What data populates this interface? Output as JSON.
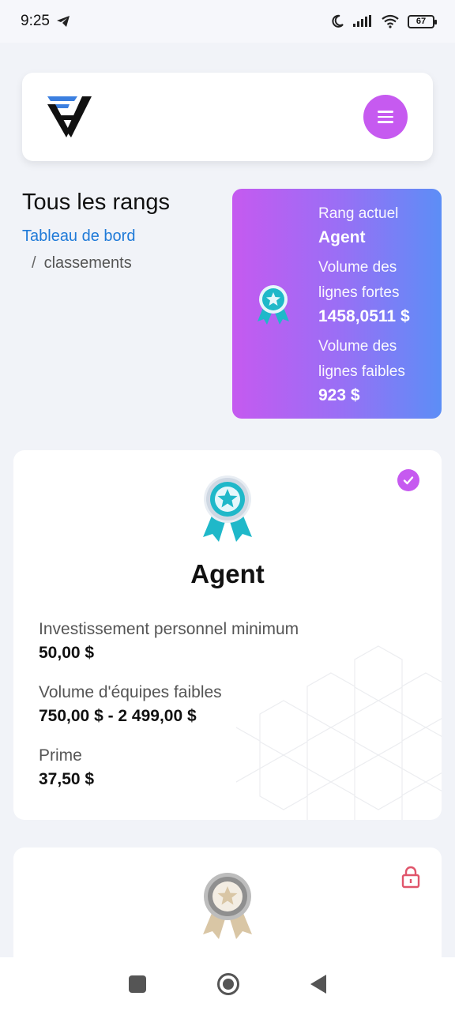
{
  "status_bar": {
    "time": "9:25",
    "battery": "67"
  },
  "header": {
    "logo_icon": "brand-logo-icon",
    "menu_icon": "hamburger-menu-icon",
    "accent_color": "#c65af0"
  },
  "page": {
    "title": "Tous les rangs",
    "breadcrumb_link": "Tableau de bord",
    "breadcrumb_separator": "/",
    "breadcrumb_current": "classements"
  },
  "rank_summary": {
    "current_rank_label": "Rang actuel",
    "current_rank_value": "Agent",
    "strong_volume_label": "Volume des lignes fortes",
    "strong_volume_value": "1458,0511 $",
    "weak_volume_label": "Volume des lignes faibles",
    "weak_volume_value": "923 $",
    "gradient_colors": [
      "#c55af0",
      "#5c8ef6"
    ]
  },
  "tiers": [
    {
      "title": "Agent",
      "status": "achieved",
      "status_icon": "check-circle-icon",
      "badge_color": "#1fb8c9",
      "rows": [
        {
          "label": "Investissement personnel minimum",
          "value": "50,00 $"
        },
        {
          "label": "Volume d'équipes faibles",
          "value": "750,00 $ - 2 499,00 $"
        },
        {
          "label": "Prime",
          "value": "37,50 $"
        }
      ]
    },
    {
      "title": "",
      "status": "locked",
      "status_icon": "lock-icon",
      "badge_color": "#d9c6a5"
    }
  ],
  "nav_bar": {
    "recent_icon": "recent-apps-icon",
    "home_icon": "home-icon",
    "back_icon": "back-icon"
  }
}
